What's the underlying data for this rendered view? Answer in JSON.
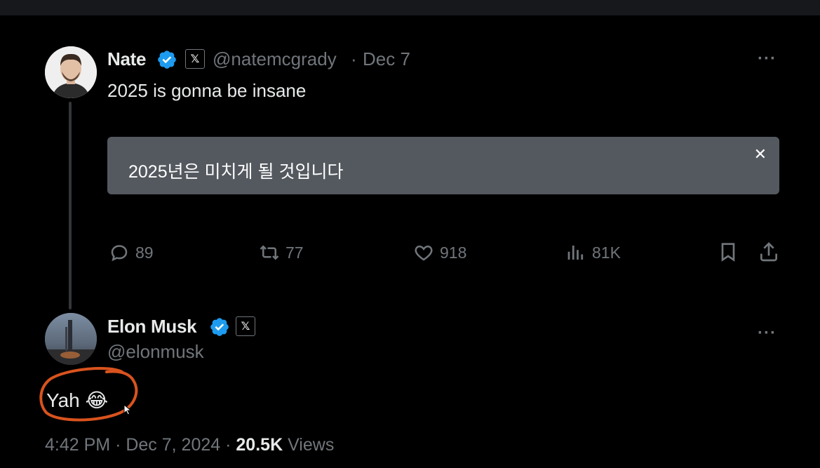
{
  "tweet": {
    "author_name": "Nate",
    "author_handle": "@natemcgrady",
    "separator": "·",
    "date": "Dec 7",
    "text": "2025 is gonna be insane",
    "translation": {
      "text": "2025년은 미치게 될 것입니다",
      "close_label": "✕"
    },
    "more_label": "···",
    "actions": {
      "replies": "89",
      "reposts": "77",
      "likes": "918",
      "views": "81K"
    }
  },
  "reply": {
    "author_name": "Elon Musk",
    "author_handle": "@elonmusk",
    "text": "Yah 😂",
    "more_label": "···",
    "footer": {
      "time": "4:42 PM",
      "sep1": "·",
      "date": "Dec 7, 2024",
      "sep2": "·",
      "views_count": "20.5K",
      "views_label": "Views"
    }
  },
  "badge": {
    "x_label": "𝕏"
  },
  "colors": {
    "background": "#000000",
    "text_primary": "#e7e9ea",
    "text_secondary": "#71767b",
    "verified_blue": "#1d9bf0",
    "translation_box": "#54595f",
    "annotation_circle": "#d9531e"
  },
  "icons": [
    "verified-icon",
    "x-badge-icon",
    "more-icon",
    "reply-icon",
    "repost-icon",
    "like-icon",
    "views-icon",
    "bookmark-icon",
    "share-icon",
    "close-icon"
  ]
}
